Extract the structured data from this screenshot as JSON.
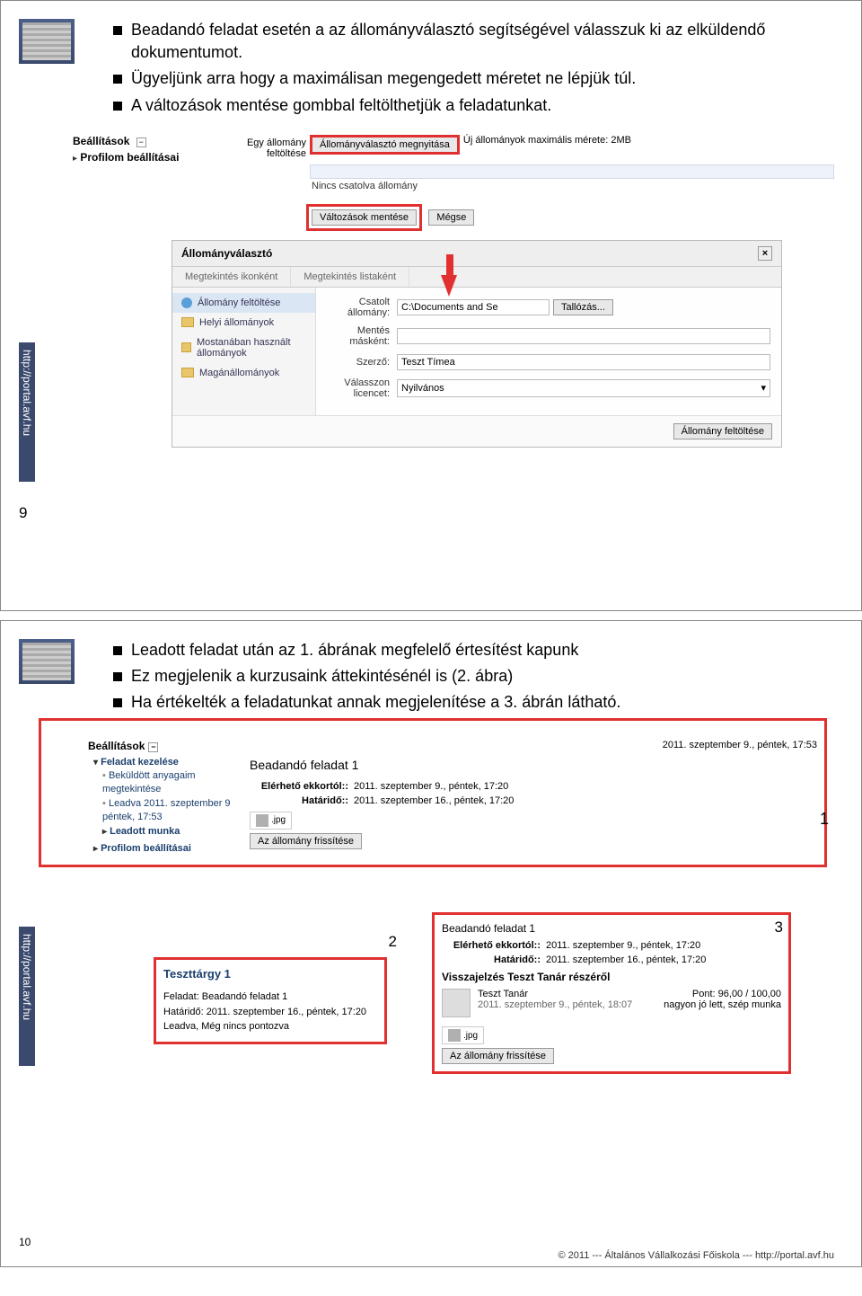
{
  "slide1": {
    "number": "9",
    "url": "http://portal.avf.hu",
    "bullets": [
      "Beadandó feladat esetén a az állományválasztó segítségével válasszuk ki az elküldendő dokumentumot.",
      "Ügyeljünk arra hogy a maximálisan megengedett méretet ne lépjük túl.",
      "A változások mentése gombbal feltölthetjük a feladatunkat."
    ],
    "settings": {
      "heading": "Beállítások",
      "profile": "Profilom beállításai",
      "upload_label": "Egy állomány feltöltése",
      "open_chooser_btn": "Állományválasztó megnyitása",
      "max_size_label": "Új állományok maximális mérete: 2MB",
      "no_attach": "Nincs csatolva állomány",
      "save_btn": "Változások mentése",
      "cancel_btn": "Mégse"
    },
    "dialog": {
      "title": "Állományválasztó",
      "tab1": "Megtekintés ikonként",
      "tab2": "Megtekintés listaként",
      "side": {
        "upload": "Állomány feltöltése",
        "local": "Helyi állományok",
        "recent": "Mostanában használt állományok",
        "private": "Magánállományok"
      },
      "form": {
        "attach_label": "Csatolt állomány:",
        "attach_value": "C:\\Documents and Se",
        "browse_btn": "Tallózás...",
        "saveas_label": "Mentés másként:",
        "saveas_value": "",
        "author_label": "Szerző:",
        "author_value": "Teszt Tímea",
        "licence_label": "Válasszon licencet:",
        "licence_value": "Nyilvános",
        "upload_btn": "Állomány feltöltése"
      }
    }
  },
  "slide2": {
    "number": "10",
    "url": "http://portal.avf.hu",
    "bullets": [
      "Leadott feladat után az 1. ábrának megfelelő értesítést kapunk",
      "Ez megjelenik a kurzusaink áttekintésénél is (2. ábra)",
      "Ha értékelték a feladatunkat annak megjelenítése a 3. ábrán látható."
    ],
    "settings": {
      "heading": "Beállítások",
      "manage": "Feladat kezelése",
      "sent": "Beküldött anyagaim megtekintése",
      "submitted": "Leadva 2011. szeptember 9 péntek, 17:53",
      "work": "Leadott munka",
      "profile": "Profilom beállításai"
    },
    "right": {
      "timestamp": "2011. szeptember 9., péntek, 17:53",
      "title": "Beadandó feladat 1",
      "avail_label": "Elérhető ekkortól::",
      "avail_value": "2011. szeptember 9., péntek, 17:20",
      "due_label": "Határidő::",
      "due_value": "2011. szeptember 16., péntek, 17:20",
      "file_ext": ".jpg",
      "refresh_btn": "Az állomány frissítése"
    },
    "panel2": {
      "num": "2",
      "course": "Teszttárgy 1",
      "task_line": "Feladat: Beadandó feladat 1",
      "due_line": "Határidő: 2011. szeptember 16., péntek, 17:20",
      "status_line": "Leadva, Még nincs pontozva"
    },
    "panel3": {
      "num": "3",
      "title": "Beadandó feladat 1",
      "avail_label": "Elérhető ekkortól::",
      "avail_value": "2011. szeptember 9., péntek, 17:20",
      "due_label": "Határidő::",
      "due_value": "2011. szeptember 16., péntek, 17:20",
      "fb_heading": "Visszajelzés Teszt Tanár részéről",
      "teacher": "Teszt Tanár",
      "fb_time": "2011. szeptember 9., péntek, 18:07",
      "score": "Pont: 96,00 / 100,00",
      "comment": "nagyon jó lett, szép munka",
      "file_ext": ".jpg",
      "refresh_btn": "Az állomány frissítése"
    },
    "one_tag": "1",
    "footer": "© 2011 --- Általános Vállalkozási Főiskola --- http://portal.avf.hu"
  }
}
